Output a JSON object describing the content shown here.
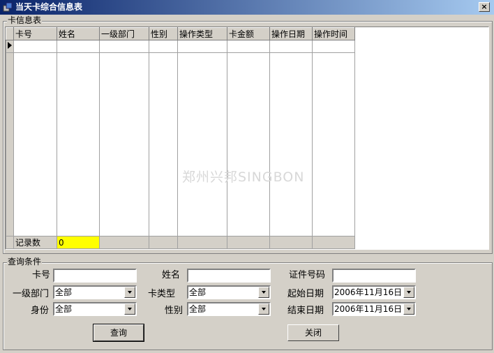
{
  "window": {
    "title": "当天卡综合信息表",
    "close_glyph": "×"
  },
  "grid_group": {
    "label": "卡信息表"
  },
  "grid": {
    "columns": [
      "卡号",
      "姓名",
      "一级部门",
      "性别",
      "操作类型",
      "卡金额",
      "操作日期",
      "操作时间"
    ],
    "footer": {
      "label": "记录数",
      "count": "0"
    }
  },
  "watermark": "郑州兴邦SINGBON",
  "query": {
    "label": "查询条件",
    "card_no": {
      "label": "卡号",
      "value": ""
    },
    "name": {
      "label": "姓名",
      "value": ""
    },
    "id_no": {
      "label": "证件号码",
      "value": ""
    },
    "dept": {
      "label": "一级部门",
      "value": "全部"
    },
    "card_type": {
      "label": "卡类型",
      "value": "全部"
    },
    "start_date": {
      "label": "起始日期",
      "value": "2006年11月16日"
    },
    "identity": {
      "label": "身份",
      "value": "全部"
    },
    "gender": {
      "label": "性别",
      "value": "全部"
    },
    "end_date": {
      "label": "结束日期",
      "value": "2006年11月16日"
    },
    "search_label": "查询",
    "close_label": "关闭"
  }
}
